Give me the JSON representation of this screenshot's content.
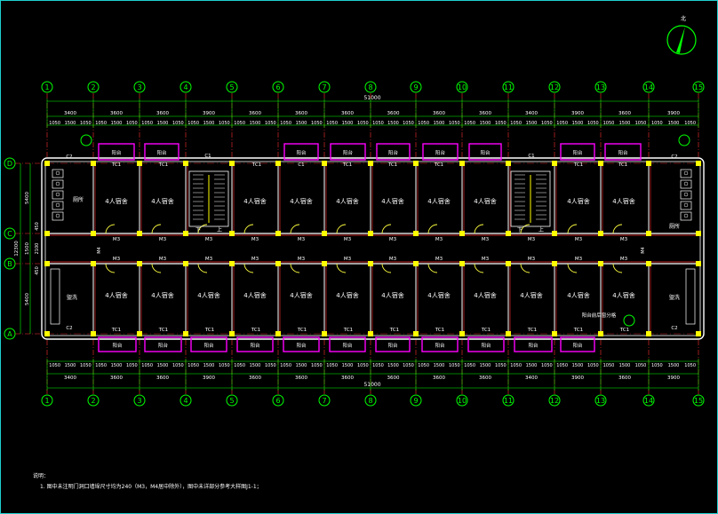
{
  "axes": [
    "1",
    "2",
    "3",
    "4",
    "5",
    "6",
    "7",
    "8",
    "9",
    "10",
    "11",
    "12",
    "13",
    "14",
    "15"
  ],
  "row_axes": [
    "D",
    "C",
    "B",
    "A"
  ],
  "dims": {
    "total": "51000",
    "bays": [
      "3400",
      "3600",
      "3600",
      "3900",
      "3600",
      "3600",
      "3600",
      "3600",
      "3600",
      "3600",
      "3400",
      "3900",
      "3600",
      "3900"
    ],
    "top_sub": [
      "1050",
      "1500",
      "1050",
      "1050",
      "1500",
      "1050",
      "1050",
      "1500",
      "1050",
      "1050",
      "1500",
      "1050",
      "1050",
      "1500",
      "1050",
      "1050",
      "1500",
      "1050",
      "1050",
      "1500",
      "1050",
      "1050",
      "1500",
      "1050",
      "1050",
      "1500",
      "1050",
      "1050",
      "1500",
      "1050",
      "1050",
      "1500",
      "1050",
      "1050",
      "1500",
      "1050",
      "1050",
      "1500",
      "1050",
      "1050",
      "1500",
      "1050",
      "1200",
      "1500",
      "1200",
      "1200",
      "1500",
      "1200"
    ],
    "left_total": "12300",
    "left_parts": [
      "5400",
      "1500",
      "5400"
    ],
    "left_small": [
      "450",
      "2100",
      "450"
    ]
  },
  "rooms": {
    "dorm": "4人宿舍",
    "balcony": "阳台",
    "window_top": "TC1",
    "window_c1": "C1",
    "window_c2": "C2",
    "door_m3": "M3",
    "door_m4": "M4",
    "washroom": "盥洗",
    "toilet": "厕所",
    "stair_up": "上",
    "stair_down": "下",
    "balcony_note": "阳台前后窗分格",
    "north_mark": "北"
  },
  "note": {
    "title": "说明：",
    "line1": "1. 图中未注明门洞口墙垛尺寸均为240（M3，M4居中除外），图中未详部分参考大样图J1-1；"
  },
  "colors": {
    "wall": "#ffffff",
    "column": "#ffff00",
    "window": "#ff00ff",
    "dim": "#00ff00",
    "axis": "#ff3030",
    "door": "#ffff40",
    "frame": "#1fd0d0"
  }
}
